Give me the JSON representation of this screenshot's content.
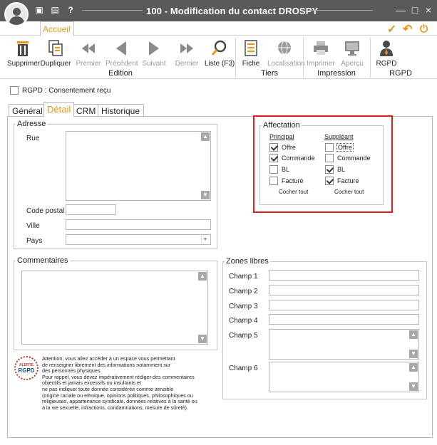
{
  "window": {
    "title": "100 - Modification du contact DROSPY",
    "controls": [
      "—",
      "□",
      "×"
    ]
  },
  "ribbon": {
    "tab": "Accueil",
    "buttons": {
      "supprimer": "Supprimer",
      "dupliquer": "Dupliquer",
      "premier": "Premier",
      "precedent": "Précédent",
      "suivant": "Suivant",
      "dernier": "Dernier",
      "liste": "Liste (F3)",
      "fiche": "Fiche",
      "localisation": "Localisation",
      "imprimer": "Imprimer",
      "apercu": "Aperçu",
      "rgpd": "RGPD"
    },
    "groups": {
      "edition": "Edition",
      "tiers": "Tiers",
      "impression": "Impression",
      "rgpd": "RGPD"
    }
  },
  "rgpd_consent": {
    "label": "RGPD : Consentement reçu",
    "checked": false
  },
  "tabs": [
    "Général",
    "Détail",
    "CRM",
    "Historique"
  ],
  "active_tab": "Détail",
  "adresse": {
    "legend": "Adresse",
    "rue_label": "Rue",
    "rue_value": "",
    "code_postal_label": "Code postal",
    "code_postal_value": "",
    "ville_label": "Ville",
    "ville_value": "",
    "pays_label": "Pays",
    "pays_value": ""
  },
  "affectation": {
    "legend": "Affectation",
    "principal_header": "Principal",
    "suppleant_header": "Suppléant",
    "principal": [
      {
        "label": "Offre",
        "checked": true
      },
      {
        "label": "Commande",
        "checked": true
      },
      {
        "label": "BL",
        "checked": false
      },
      {
        "label": "Facture",
        "checked": false
      }
    ],
    "suppleant": [
      {
        "label": "Offre",
        "checked": false
      },
      {
        "label": "Commande",
        "checked": false
      },
      {
        "label": "BL",
        "checked": true
      },
      {
        "label": "Facture",
        "checked": true
      }
    ],
    "cocher_tout": "Cocher tout"
  },
  "commentaires": {
    "legend": "Commentaires",
    "value": ""
  },
  "zones_libres": {
    "legend": "Zones libres",
    "champs": [
      "Champ 1",
      "Champ 2",
      "Champ 3",
      "Champ 4",
      "Champ 5",
      "Champ 6"
    ]
  },
  "alert": {
    "badge_top": "ALERTE",
    "badge_main": "RGPD",
    "lines": [
      "Attention, vous allez accéder à un espace vous permettant",
      "de renseigner librement des informations notamment sur",
      "des personnes physiques.",
      "Pour rappel, vous devez impérativement rédiger des commentaires",
      "objectifs et jamais excessifs ou insultants et",
      "ne pas indiquer toute donnée considérée comme sensible",
      "(origine raciale ou ethnique, opinions politiques, philosophiques ou",
      "religieuses, appartenance syndicale, données relatives à la santé ou",
      "à la vie sexuelle, infractions, condamnations, mesure de sûreté)."
    ]
  }
}
